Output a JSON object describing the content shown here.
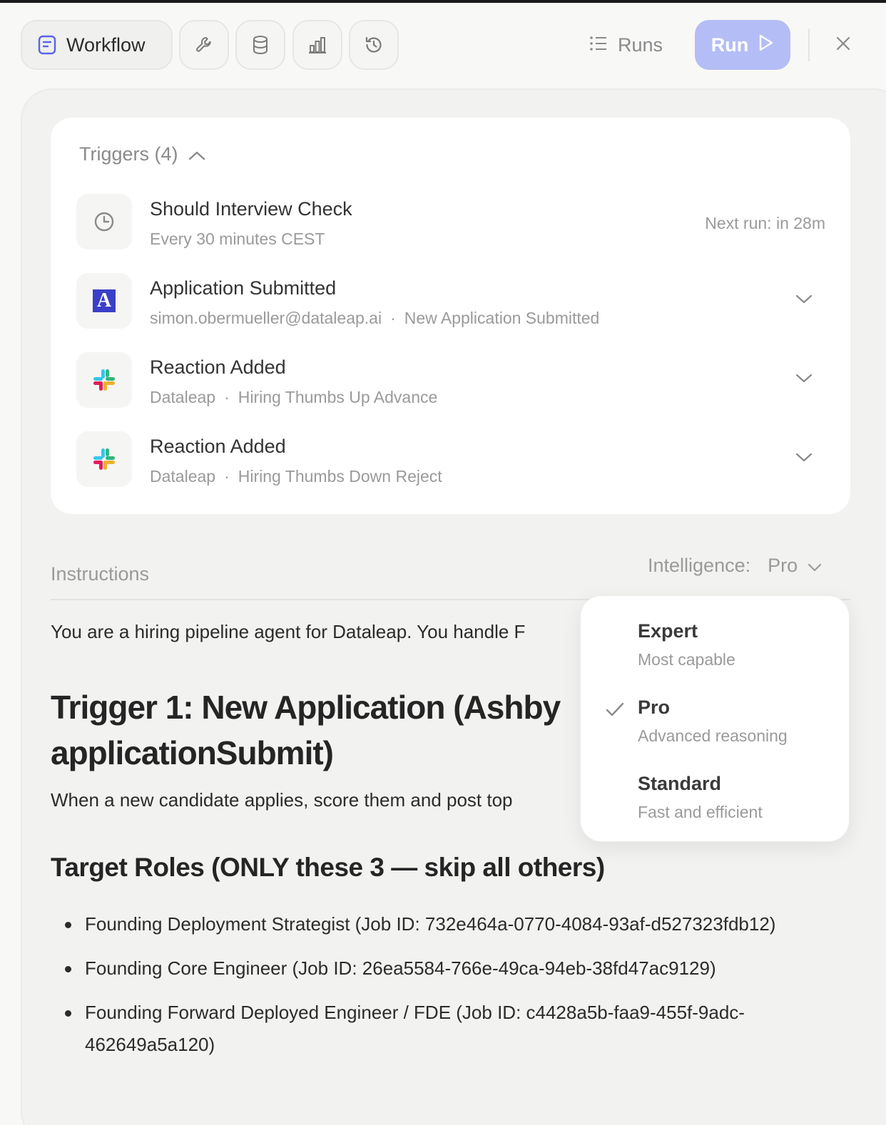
{
  "toolbar": {
    "workflow_label": "Workflow",
    "runs_label": "Runs",
    "run_label": "Run",
    "icons": [
      "document-icon",
      "wrench-icon",
      "database-icon",
      "bar-chart-icon",
      "history-icon",
      "list-icon",
      "play-icon",
      "close-icon"
    ]
  },
  "triggers": {
    "header": "Triggers (4)",
    "items": [
      {
        "title": "Should Interview Check",
        "sub": "Every 30 minutes CEST",
        "right": "Next run: in 28m",
        "icon": "clock-icon"
      },
      {
        "title": "Application Submitted",
        "sub_a": "simon.obermueller@dataleap.ai",
        "sub_b": "New Application Submitted",
        "icon": "ashby-logo"
      },
      {
        "title": "Reaction Added",
        "sub_a": "Dataleap",
        "sub_b": "Hiring Thumbs Up Advance",
        "icon": "slack-logo"
      },
      {
        "title": "Reaction Added",
        "sub_a": "Dataleap",
        "sub_b": "Hiring Thumbs Down Reject",
        "icon": "slack-logo"
      }
    ]
  },
  "instructions": {
    "label": "Instructions",
    "intelligence_label": "Intelligence:",
    "intelligence_value": "Pro",
    "lead": "You are a hiring pipeline agent for Dataleap. You handle F",
    "h1": "Trigger 1: New Application (Ashby applicationSubmit)",
    "when": "When a new candidate applies, score them and post top",
    "h2": "Target Roles (ONLY these 3 — skip all others)",
    "roles": [
      "Founding Deployment Strategist (Job ID: 732e464a-0770-4084-93af-d527323fdb12)",
      "Founding Core Engineer (Job ID: 26ea5584-766e-49ca-94eb-38fd47ac9129)",
      "Founding Forward Deployed Engineer / FDE (Job ID: c4428a5b-faa9-455f-9adc-462649a5a120)"
    ]
  },
  "intelligence_menu": {
    "options": [
      {
        "name": "Expert",
        "desc": "Most capable",
        "selected": false
      },
      {
        "name": "Pro",
        "desc": "Advanced reasoning",
        "selected": true
      },
      {
        "name": "Standard",
        "desc": "Fast and efficient",
        "selected": false
      }
    ]
  },
  "colors": {
    "accent": "#b4bdf5",
    "ashby": "#3b3fc7"
  }
}
